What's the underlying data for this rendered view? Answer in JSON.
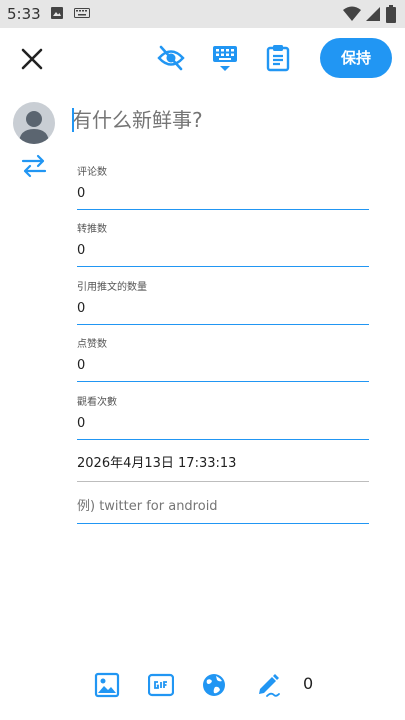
{
  "status_bar": {
    "time": "5:33"
  },
  "toolbar": {
    "keep_label": "保持"
  },
  "compose": {
    "placeholder": "有什么新鲜事?"
  },
  "fields": [
    {
      "label": "评论数",
      "value": "0"
    },
    {
      "label": "转推数",
      "value": "0"
    },
    {
      "label": "引用推文的数量",
      "value": "0"
    },
    {
      "label": "点赞数",
      "value": "0"
    },
    {
      "label": "觀看次數",
      "value": "0"
    }
  ],
  "date": {
    "value": "2026年4月13日 17:33:13"
  },
  "source": {
    "placeholder": "例) twitter for android"
  },
  "bottom_bar": {
    "char_count": "0"
  },
  "colors": {
    "accent": "#2196f3",
    "status_bar": "#e6e6e6"
  }
}
